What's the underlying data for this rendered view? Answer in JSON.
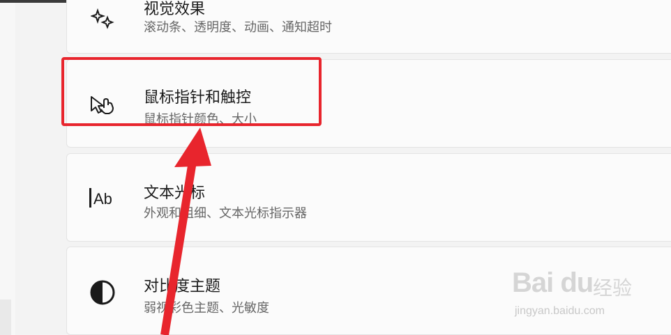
{
  "settings_list": {
    "items": [
      {
        "title": "视觉效果",
        "description": "滚动条、透明度、动画、通知超时",
        "icon": "sparkle-icon"
      },
      {
        "title": "鼠标指针和触控",
        "description": "鼠标指针颜色、大小",
        "icon": "pointer-hand-icon"
      },
      {
        "title": "文本光标",
        "description": "外观和粗细、文本光标指示器",
        "icon": "text-cursor-icon"
      },
      {
        "title": "对比度主题",
        "description": "弱视彩色主题、光敏度",
        "icon": "contrast-icon"
      }
    ]
  },
  "annotation": {
    "highlight_color": "#e8252d"
  },
  "watermark": {
    "logo_text": "Bai du",
    "cn_text": "经验",
    "url_text": "jingyan.baidu.com"
  }
}
